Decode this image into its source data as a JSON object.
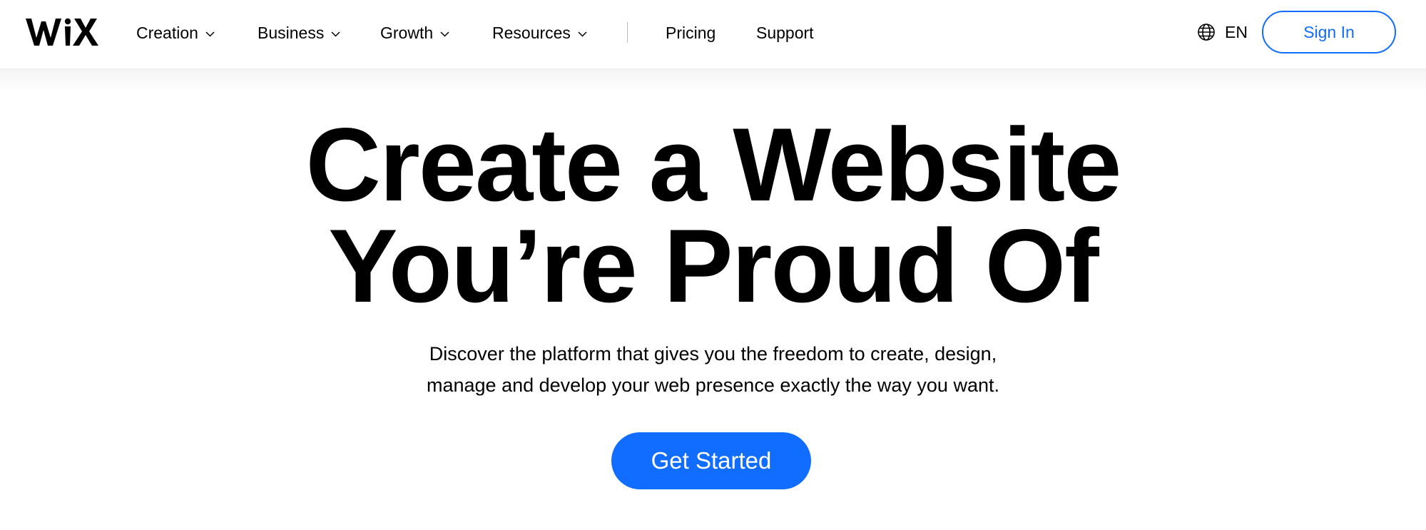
{
  "brand": {
    "logo_text": "WiX",
    "accent_color": "#116DFF"
  },
  "nav": {
    "items": [
      {
        "label": "Creation",
        "has_dropdown": true,
        "icon": "chevron-down-icon"
      },
      {
        "label": "Business",
        "has_dropdown": true,
        "icon": "chevron-down-icon"
      },
      {
        "label": "Growth",
        "has_dropdown": true,
        "icon": "chevron-down-icon"
      },
      {
        "label": "Resources",
        "has_dropdown": true,
        "icon": "chevron-down-icon"
      },
      {
        "label": "Pricing",
        "has_dropdown": false
      },
      {
        "label": "Support",
        "has_dropdown": false
      }
    ]
  },
  "header_right": {
    "language": {
      "icon": "globe-icon",
      "label": "EN"
    },
    "signin_label": "Sign In"
  },
  "hero": {
    "title_lines": [
      "Create a Website",
      "You’re Proud Of"
    ],
    "subtitle_lines": [
      "Discover the platform that gives you the freedom to create, design,",
      "manage and develop your web presence exactly the way you want."
    ],
    "cta_label": "Get Started"
  }
}
